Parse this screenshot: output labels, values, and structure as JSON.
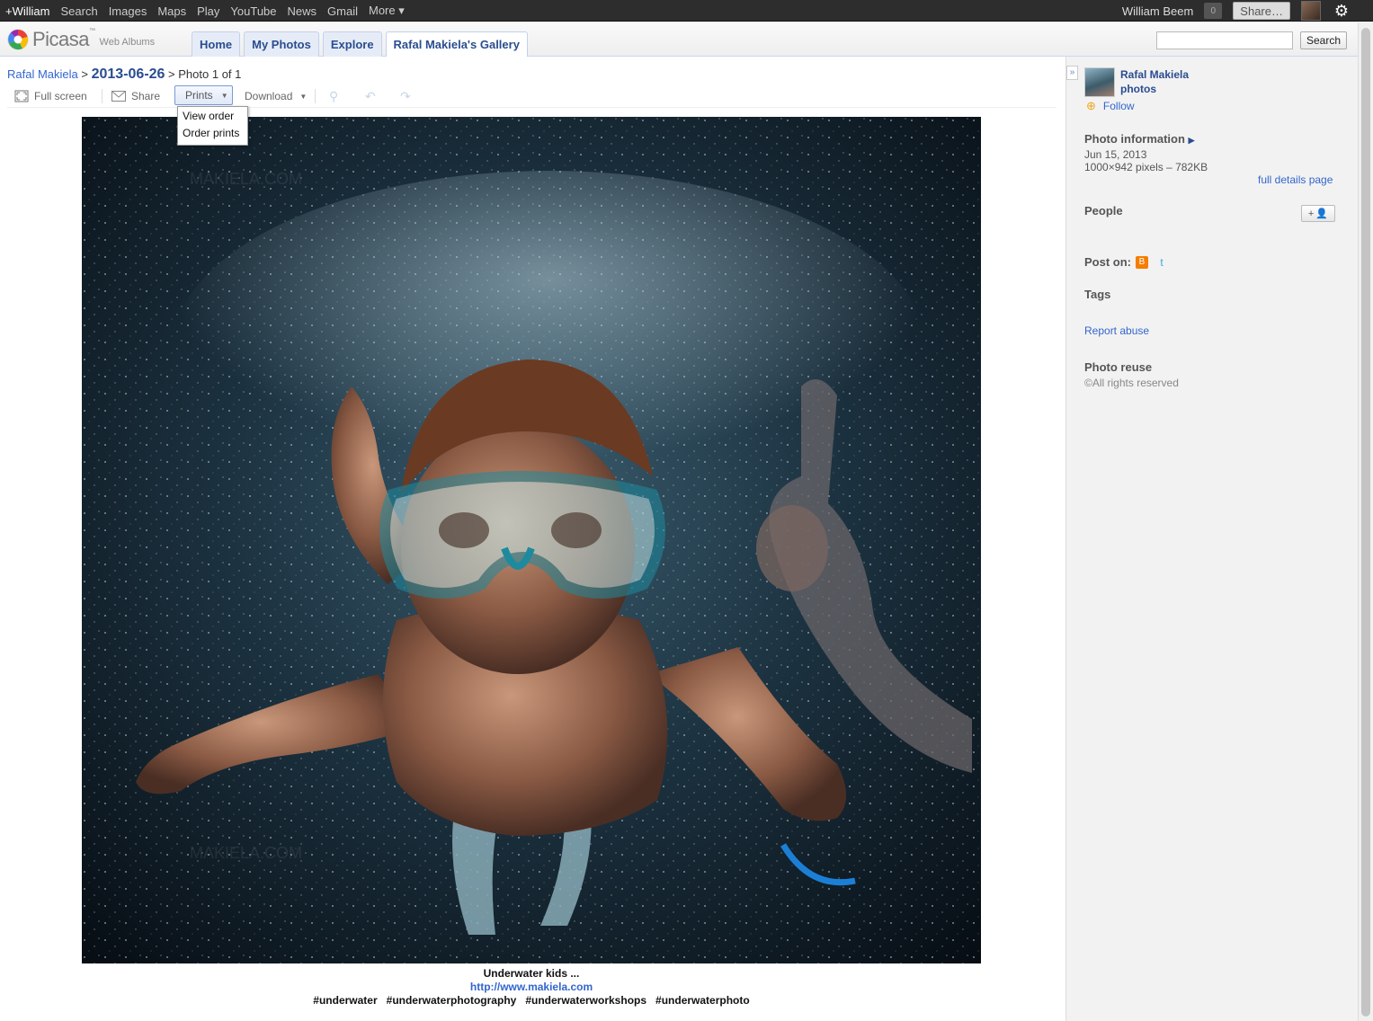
{
  "google_bar": {
    "links": [
      "+William",
      "Search",
      "Images",
      "Maps",
      "Play",
      "YouTube",
      "News",
      "Gmail",
      "More ▾"
    ],
    "user_name": "William Beem",
    "notification_count": "0",
    "share_label": "Share…",
    "settings_icon": "gear-icon"
  },
  "header": {
    "logo_text": "Picasa",
    "logo_tm": "™",
    "logo_sub": "Web Albums",
    "tabs": [
      "Home",
      "My Photos",
      "Explore",
      "Rafal Makiela's Gallery"
    ],
    "selected_tab": "Rafal Makiela's Gallery",
    "search_value": "",
    "search_button": "Search"
  },
  "breadcrumb": {
    "owner": "Rafal Makiela",
    "sep1": " > ",
    "album": "2013-06-26",
    "sep2": " > ",
    "position": "Photo 1 of 1"
  },
  "toolbar": {
    "fullscreen": "Full screen",
    "share": "Share",
    "prints": "Prints",
    "download": "Download",
    "prints_menu": [
      "View order",
      "Order prints"
    ]
  },
  "photo": {
    "caption_title": "Underwater kids ...",
    "caption_url": "http://www.makiela.com",
    "caption_tags": "#underwater   #underwaterphotography   #underwaterworkshops   #underwaterphoto"
  },
  "sidebar": {
    "owner_line1": "Rafal Makiela",
    "owner_line2": "photos",
    "follow": "Follow",
    "photo_info_heading": "Photo information",
    "date": "Jun 15, 2013",
    "dimensions": "1000×942 pixels – 782KB",
    "full_details": "full details page",
    "people_heading": "People",
    "add_people": "+",
    "post_on": "Post on:",
    "tags_heading": "Tags",
    "report_abuse": "Report abuse",
    "photo_reuse_heading": "Photo reuse",
    "rights": "All rights reserved"
  },
  "colors": {
    "link": "#3366cc",
    "tab_text": "#2a4d8f",
    "gbar": "#2d2d2d",
    "sidebar_bg": "#f2f2f2"
  }
}
